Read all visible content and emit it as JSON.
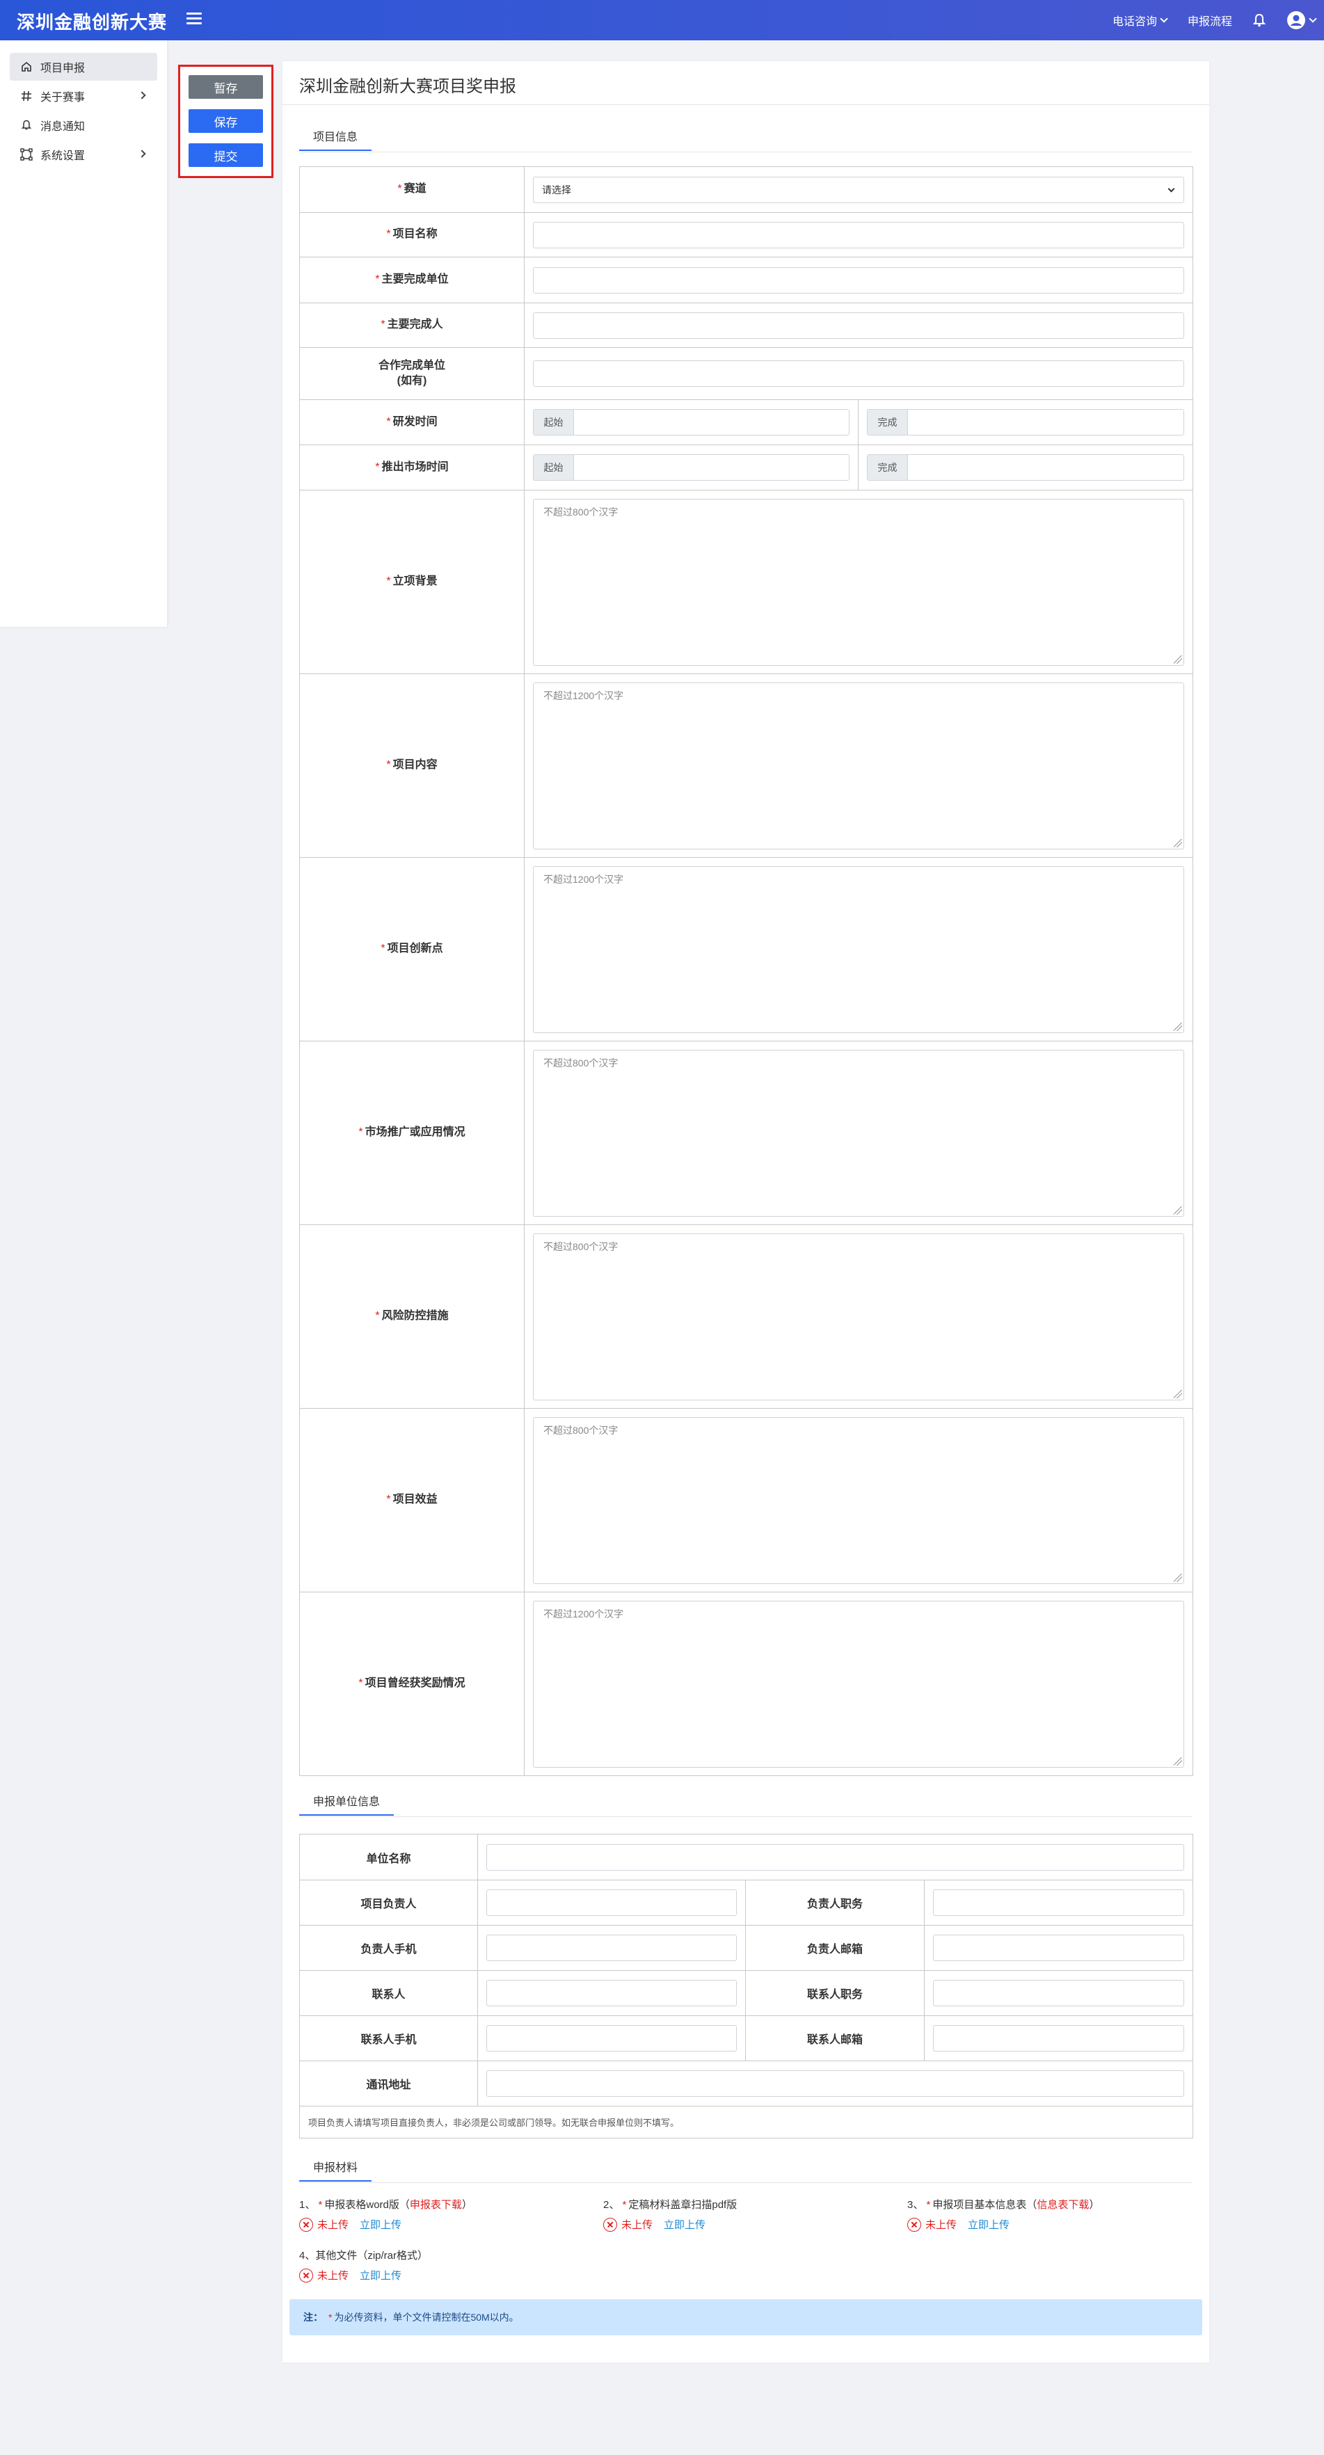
{
  "header": {
    "brand": "深圳金融创新大赛",
    "phone_consult": "电话咨询",
    "apply_process": "申报流程"
  },
  "sidebar": {
    "items": [
      {
        "label": "项目申报",
        "icon": "home-icon"
      },
      {
        "label": "关于赛事",
        "icon": "hash-icon"
      },
      {
        "label": "消息通知",
        "icon": "bell-icon"
      },
      {
        "label": "系统设置",
        "icon": "nodes-icon"
      }
    ]
  },
  "actions": {
    "draft": "暂存",
    "save": "保存",
    "submit": "提交"
  },
  "page": {
    "title": "深圳金融创新大赛项目奖申报"
  },
  "project_section": {
    "tab": "项目信息",
    "track_label": "赛道",
    "track_value": "请选择",
    "name_label": "项目名称",
    "main_unit_label": "主要完成单位",
    "main_person_label": "主要完成人",
    "coop_unit_label_1": "合作完成单位",
    "coop_unit_label_2": "(如有)",
    "dev_time_label": "研发时间",
    "market_time_label": "推出市场时间",
    "start": "起始",
    "end": "完成",
    "background_label": "立项背景",
    "background_ph": "不超过800个汉字",
    "content_label": "项目内容",
    "content_ph": "不超过1200个汉字",
    "innovation_label": "项目创新点",
    "innovation_ph": "不超过1200个汉字",
    "market_label": "市场推广或应用情况",
    "market_ph": "不超过800个汉字",
    "risk_label": "风险防控措施",
    "risk_ph": "不超过800个汉字",
    "benefit_label": "项目效益",
    "benefit_ph": "不超过800个汉字",
    "awards_label": "项目曾经获奖励情况",
    "awards_ph": "不超过1200个汉字"
  },
  "unit_section": {
    "tab": "申报单位信息",
    "unit_name": "单位名称",
    "leader": "项目负责人",
    "leader_title": "负责人职务",
    "leader_phone": "负责人手机",
    "leader_email": "负责人邮箱",
    "contact": "联系人",
    "contact_title": "联系人职务",
    "contact_phone": "联系人手机",
    "contact_email": "联系人邮箱",
    "address": "通讯地址",
    "note": "项目负责人请填写项目直接负责人，非必须是公司或部门领导。如无联合申报单位则不填写。"
  },
  "materials": {
    "tab": "申报材料",
    "not_uploaded": "未上传",
    "upload_now": "立即上传",
    "items": [
      {
        "prefix": "1、",
        "label": "申报表格word版（",
        "link": "申报表下载",
        "suffix": "）"
      },
      {
        "prefix": "2、",
        "label": "定稿材料盖章扫描pdf版",
        "link": "",
        "suffix": ""
      },
      {
        "prefix": "3、",
        "label": "申报项目基本信息表（",
        "link": "信息表下载",
        "suffix": "）"
      },
      {
        "prefix": "4、",
        "label": "其他文件（zip/rar格式）",
        "link": "",
        "suffix": ""
      }
    ]
  },
  "notice": {
    "title": "注：",
    "text": "为必传资料，单个文件请控制在50M以内。"
  }
}
